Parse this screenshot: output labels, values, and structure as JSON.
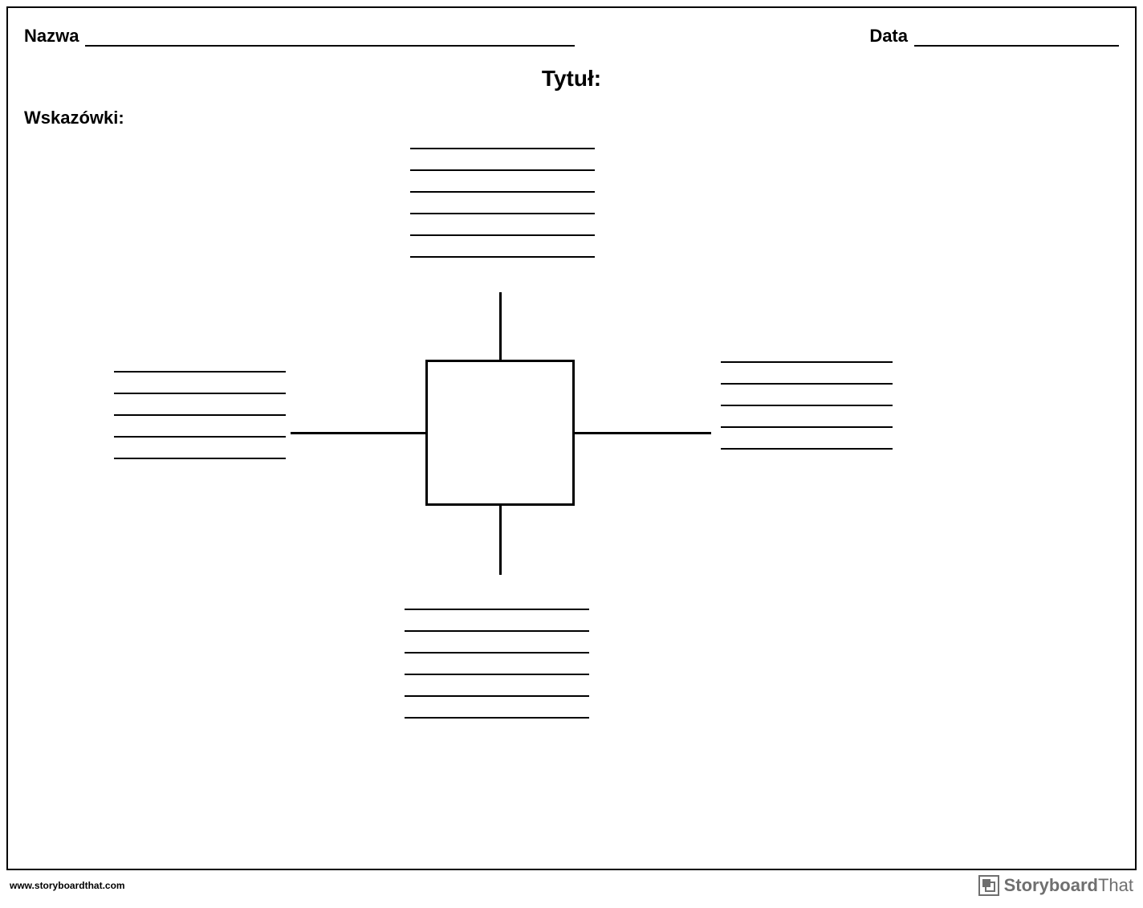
{
  "header": {
    "name_label": "Nazwa",
    "date_label": "Data"
  },
  "title_label": "Tytuł:",
  "hints_label": "Wskazówki:",
  "diagram": {
    "groups": {
      "top_lines": 6,
      "left_lines": 5,
      "right_lines": 5,
      "bottom_lines": 6
    }
  },
  "footer": {
    "url": "www.storyboardthat.com",
    "brand_bold": "Storyboard",
    "brand_light": "That"
  }
}
